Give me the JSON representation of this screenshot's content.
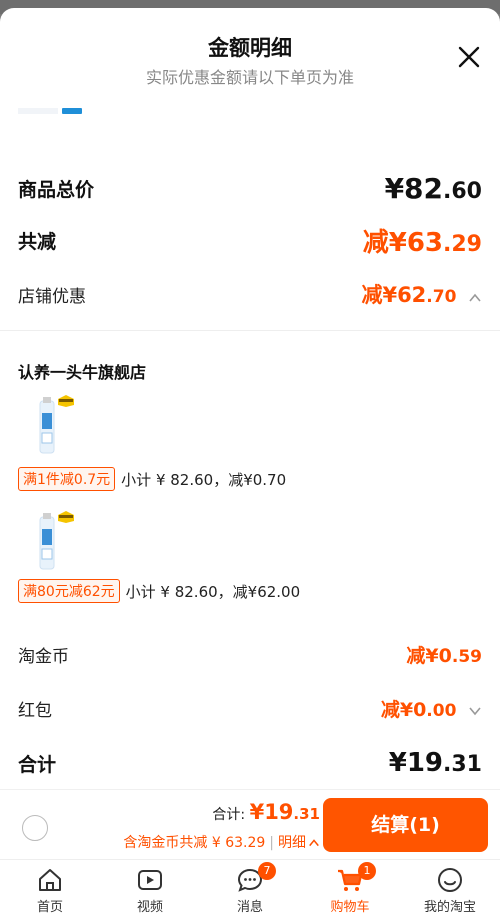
{
  "header": {
    "title": "金额明细",
    "subtitle": "实际优惠金额请以下单页为准"
  },
  "summary": {
    "goods_total_label": "商品总价",
    "goods_total_int": "¥82",
    "goods_total_dec": ".60",
    "total_reduce_label": "共减",
    "total_reduce_int": "减¥63",
    "total_reduce_dec": ".29",
    "shop_discount_label": "店铺优惠",
    "shop_discount_int": "减¥62",
    "shop_discount_dec": ".70"
  },
  "shop": {
    "name": "认养一头牛旗舰店",
    "promos": [
      {
        "tag": "满1件减0.7元",
        "text": "小计 ¥ 82.60，减¥0.70"
      },
      {
        "tag": "满80元减62元",
        "text": "小计 ¥ 82.60，减¥62.00"
      }
    ]
  },
  "other": {
    "coin_label": "淘金币",
    "coin_int": "减¥0",
    "coin_dec": ".59",
    "redpack_label": "红包",
    "redpack_int": "减¥0",
    "redpack_dec": ".00",
    "total_label": "合计",
    "total_int": "¥19",
    "total_dec": ".31"
  },
  "footer": {
    "total_prefix": "合计: ",
    "total_int": "¥19",
    "total_dec": ".31",
    "saving_text": "含淘金币共减 ¥ 63.29",
    "detail_label": "明细",
    "checkout_label": "结算(1)"
  },
  "tabbar": {
    "items": [
      {
        "label": "首页",
        "icon": "home-icon",
        "badge": ""
      },
      {
        "label": "视频",
        "icon": "video-icon",
        "badge": ""
      },
      {
        "label": "消息",
        "icon": "message-icon",
        "badge": "7"
      },
      {
        "label": "购物车",
        "icon": "cart-icon",
        "badge": "1"
      },
      {
        "label": "我的淘宝",
        "icon": "profile-icon",
        "badge": ""
      }
    ]
  },
  "colors": {
    "accent": "#ff5000",
    "checkout": "#ff5500",
    "indicator": "#1f8fd8"
  }
}
